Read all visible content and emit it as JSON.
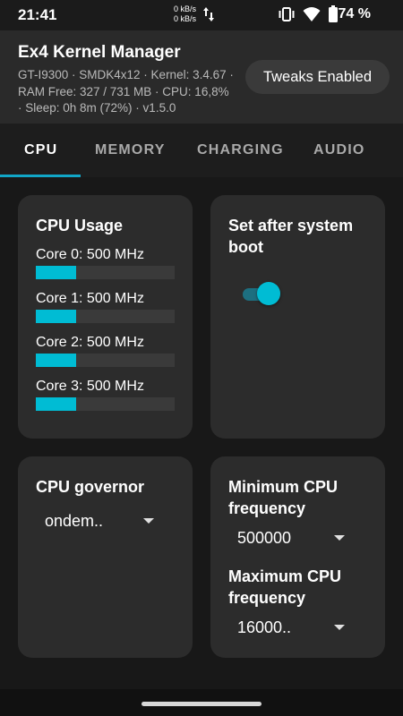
{
  "status_bar": {
    "time": "21:41",
    "net_up": "0 kB/s",
    "net_down": "0 kB/s",
    "battery_percent": "74 %",
    "icons": [
      "vibrate-icon",
      "wifi-icon",
      "battery-icon",
      "data-arrows-icon"
    ]
  },
  "header": {
    "title": "Ex4 Kernel Manager",
    "info_line1": "GT-I9300 · SMDK4x12 · Kernel: 3.4.67 ·",
    "info_line2": "RAM Free: 327 / 731 MB · CPU: 16,8%",
    "info_line3": "· Sleep: 0h 8m (72%) · v1.5.0",
    "chip": "Tweaks Enabled"
  },
  "tabs": [
    {
      "label": "CPU",
      "active": true
    },
    {
      "label": "MEMORY",
      "active": false
    },
    {
      "label": "CHARGING",
      "active": false
    },
    {
      "label": "AUDIO",
      "active": false
    }
  ],
  "cpu_usage": {
    "title": "CPU Usage",
    "cores": [
      {
        "label": "Core 0: 500 MHz",
        "load": 0.29
      },
      {
        "label": "Core 1: 500 MHz",
        "load": 0.29
      },
      {
        "label": "Core 2: 500 MHz",
        "load": 0.29
      },
      {
        "label": "Core 3: 500 MHz",
        "load": 0.29
      }
    ]
  },
  "boot_card": {
    "title_line1": "Set after system",
    "title_line2": "boot",
    "toggle_on": true
  },
  "governor_card": {
    "title": "CPU governor",
    "value": "ondem.."
  },
  "freq_card": {
    "min_title_line1": "Minimum CPU",
    "min_title_line2": "frequency",
    "min_value": "500000",
    "max_title_line1": "Maximum CPU",
    "max_title_line2": "frequency",
    "max_value": "16000.."
  },
  "colors": {
    "accent": "#00bcd4",
    "card": "#2c2c2c",
    "background": "#181818"
  }
}
